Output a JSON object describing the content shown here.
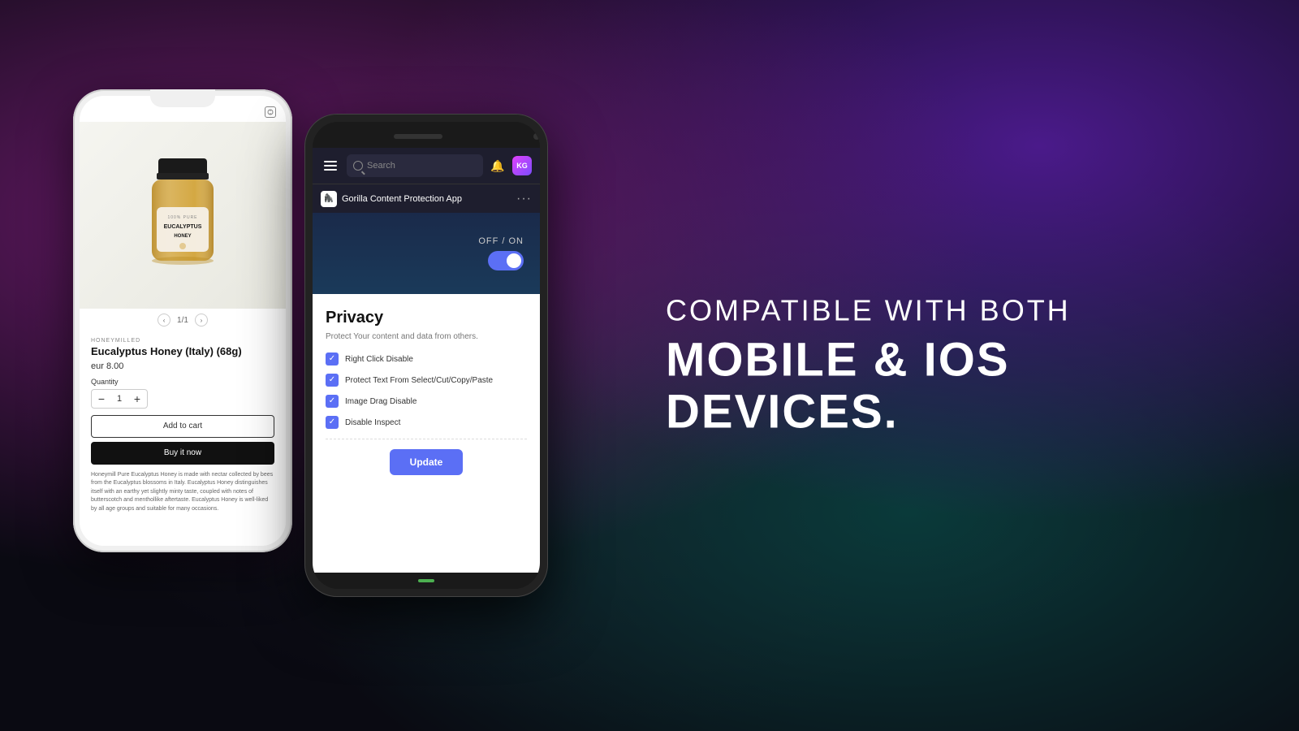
{
  "background": {
    "colors": [
      "#6b1a6b",
      "#4a1a8a",
      "#0a3a3a",
      "#0a0a12"
    ]
  },
  "left_phone": {
    "product": {
      "brand": "HONEYMILLED",
      "name": "Eucalyptus Honey (Italy) (68g)",
      "price": "eur 8.00",
      "quantity_label": "Quantity",
      "quantity_value": "1",
      "carousel_page": "1/1",
      "add_to_cart_label": "Add to cart",
      "buy_it_now_label": "Buy it now",
      "description": "Honeymill Pure Eucalyptus Honey is made with nectar collected by bees from the Eucalyptus blossoms in Italy. Eucalyptus Honey distinguishes itself with an earthy yet slightly minty taste, coupled with notes of butterscotch and menthollike aftertaste.\n\nEucalyptus Honey is well-liked by all age groups and suitable for many occasions."
    }
  },
  "right_phone": {
    "navbar": {
      "search_placeholder": "Search",
      "avatar_initials": "KG"
    },
    "app": {
      "name": "Gorilla Content Protection App",
      "icon_emoji": "🦍"
    },
    "toggle": {
      "label": "OFF / ON",
      "state": "on"
    },
    "privacy": {
      "title": "Privacy",
      "subtitle": "Protect Your content and data from others.",
      "items": [
        {
          "label": "Right Click Disable",
          "checked": true
        },
        {
          "label": "Protect Text From Select/Cut/Copy/Paste",
          "checked": true
        },
        {
          "label": "Image Drag Disable",
          "checked": true
        },
        {
          "label": "Disable Inspect",
          "checked": true
        }
      ],
      "update_button_label": "Update"
    }
  },
  "text_section": {
    "line1": "COMPATIBLE WITH BOTH",
    "line2": "MOBILE & IOS DEVICES."
  }
}
